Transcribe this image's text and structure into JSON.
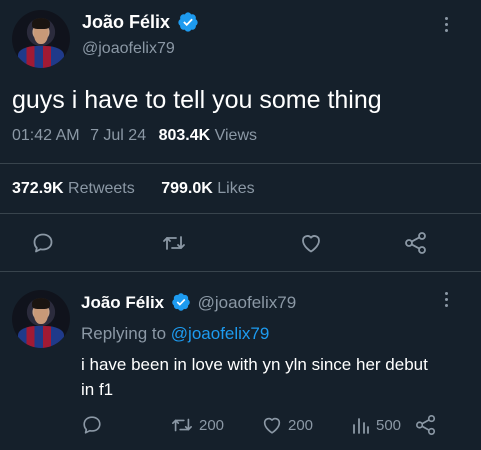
{
  "tweet": {
    "author": {
      "name": "João Félix",
      "handle": "@joaofelix79"
    },
    "text": "guys i have to tell you some thing",
    "time": "01:42 AM",
    "date": "7 Jul 24",
    "views_count": "803.4K",
    "views_label": "Views",
    "retweets_count": "372.9K",
    "retweets_label": "Retweets",
    "likes_count": "799.0K",
    "likes_label": "Likes"
  },
  "reply": {
    "author": {
      "name": "João Félix",
      "handle": "@joaofelix79"
    },
    "replying_to_label": "Replying to",
    "replying_to_handle": "@joaofelix79",
    "text_line1": "i have been in love with yn yln since her debut",
    "text_line2": "in f1",
    "retweet_count": "200",
    "like_count": "200",
    "views_count": "500"
  },
  "icons": {
    "verified": "verified-badge-icon",
    "more": "more-vertical-icon",
    "reply": "reply-icon",
    "retweet": "retweet-icon",
    "like": "heart-icon",
    "share": "share-icon",
    "views": "views-icon"
  },
  "colors": {
    "background": "#15202b",
    "text": "#ffffff",
    "muted": "#8b98a5",
    "accent": "#1d9bf0",
    "divider": "#38444d"
  }
}
